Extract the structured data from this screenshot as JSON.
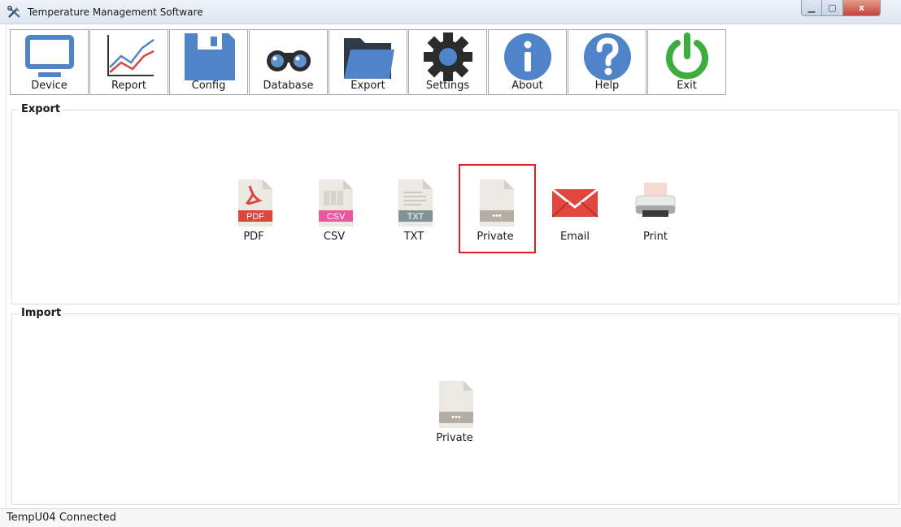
{
  "window": {
    "title": "Temperature Management Software",
    "buttons": {
      "minimize": "▁",
      "maximize": "▢",
      "close": "x"
    }
  },
  "toolbar": {
    "items": [
      {
        "label": "Device",
        "icon": "monitor-icon"
      },
      {
        "label": "Report",
        "icon": "line-chart-icon"
      },
      {
        "label": "Config",
        "icon": "floppy-disk-icon"
      },
      {
        "label": "Database",
        "icon": "binoculars-icon"
      },
      {
        "label": "Export",
        "icon": "folder-icon"
      },
      {
        "label": "Settings",
        "icon": "gear-icon"
      },
      {
        "label": "About",
        "icon": "info-icon"
      },
      {
        "label": "Help",
        "icon": "question-icon"
      },
      {
        "label": "Exit",
        "icon": "power-icon"
      }
    ]
  },
  "export": {
    "title": "Export",
    "items": [
      {
        "label": "PDF",
        "badge": "PDF",
        "icon": "pdf-file-icon",
        "color": "#d9473f"
      },
      {
        "label": "CSV",
        "badge": "CSV",
        "icon": "csv-file-icon",
        "color": "#e75aa0"
      },
      {
        "label": "TXT",
        "badge": "TXT",
        "icon": "txt-file-icon",
        "color": "#7f9395"
      },
      {
        "label": "Private",
        "badge": "•••",
        "icon": "private-file-icon",
        "color": "#b3ada3",
        "selected": true
      },
      {
        "label": "Email",
        "icon": "envelope-icon",
        "color": "#e0473e"
      },
      {
        "label": "Print",
        "icon": "printer-icon"
      }
    ]
  },
  "import": {
    "title": "Import",
    "items": [
      {
        "label": "Private",
        "badge": "•••",
        "icon": "private-file-icon",
        "color": "#b3ada3"
      }
    ]
  },
  "status": {
    "text": "TempU04 Connected"
  },
  "colors": {
    "accent_blue": "#4f84c8",
    "exit_green": "#3dae3d",
    "selection_red": "#e02020"
  }
}
